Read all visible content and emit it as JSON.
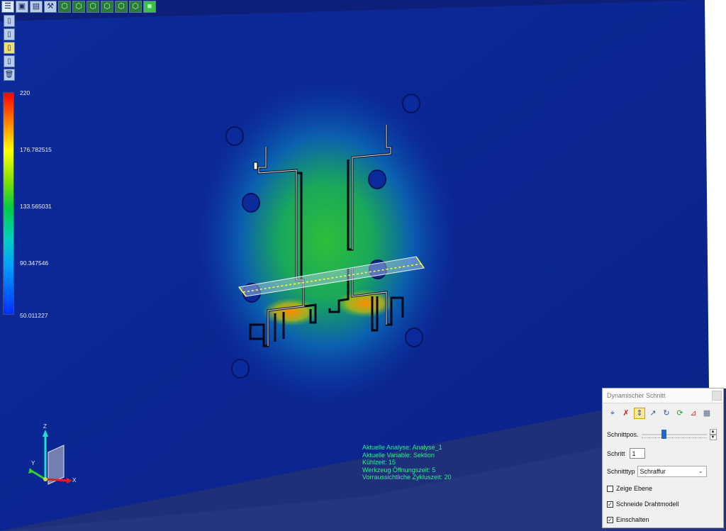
{
  "toolbar": {
    "buttons": [
      {
        "icon": "menu-icon"
      },
      {
        "icon": "save-icon"
      },
      {
        "icon": "print-icon"
      },
      {
        "icon": "tool-icon"
      },
      {
        "icon": "cube-icon"
      },
      {
        "icon": "cube-icon"
      },
      {
        "icon": "cube-icon"
      },
      {
        "icon": "cube-icon"
      },
      {
        "icon": "cube-icon"
      },
      {
        "icon": "cube-icon"
      },
      {
        "icon": "cube-icon"
      }
    ]
  },
  "side_tools": [
    {
      "icon": "cylinder-icon"
    },
    {
      "icon": "cylinder-icon"
    },
    {
      "icon": "cylinder-icon"
    },
    {
      "icon": "cylinder-icon"
    },
    {
      "icon": "trash-icon"
    }
  ],
  "legend": {
    "max": "220",
    "v2": "176.782515",
    "v3": "133.565031",
    "v4": "90.347546",
    "min": "50.011227",
    "colors": [
      "#ff0000",
      "#ffff00",
      "#00cc44",
      "#00d0c0",
      "#0030ff"
    ]
  },
  "info": {
    "analysis": "Aktuelle Analyse:  Analyse_1",
    "variable": "Aktuelle Variable:  Sektion",
    "cooling": "Kühlzeit:  15",
    "open_time": "Werkzeug Öffnungszeit:  5",
    "cycle": "Vorraussichtliche Zykluszeit:  20"
  },
  "axes": {
    "z": "Z",
    "y": "Y",
    "x": "X"
  },
  "panel": {
    "title": "Dynamischer Schnitt",
    "icons": [
      "cut-x-icon",
      "cut-x2-icon",
      "cut-y-icon",
      "cut-z-icon",
      "cut-rotate-icon",
      "cut-free-icon",
      "cut-axis-icon",
      "cube-grid-icon"
    ],
    "active_icon_index": 2,
    "position_label": "Schnittpos.",
    "slider_value_fraction": 0.33,
    "step_label": "Schritt",
    "step_value": "1",
    "type_label": "Schnitttyp",
    "type_value": "Schraffur",
    "show_plane_label": "Zeige Ebene",
    "show_plane_checked": false,
    "cut_wireframe_label": "Schneide Drahtmodell",
    "cut_wireframe_checked": true,
    "enable_label": "Einschalten",
    "enable_checked": true
  }
}
